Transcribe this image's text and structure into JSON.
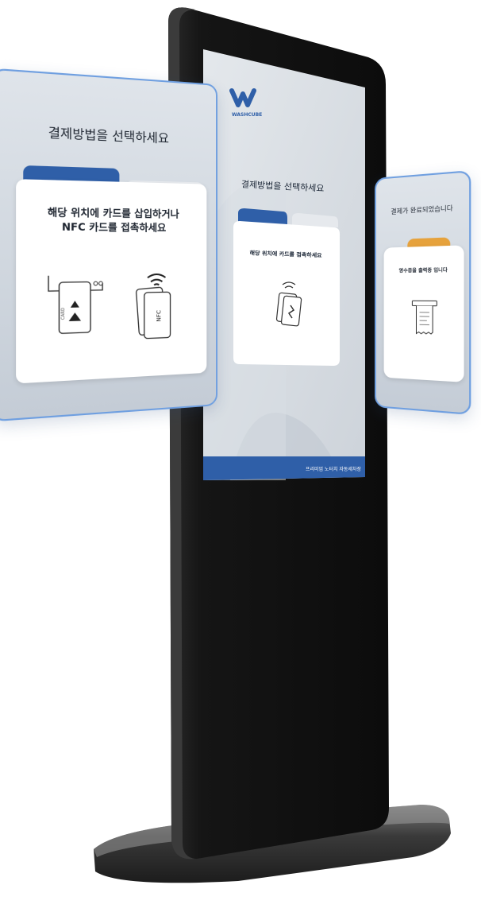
{
  "brand": {
    "name": "WASHCUBE"
  },
  "kiosk_screen": {
    "title": "결제방법을 선택하세요",
    "card_instruction": "해당 위치에 카드를 접촉하세요",
    "footer_text": "프리미엄 노터치 자동세차장"
  },
  "left_panel": {
    "title": "결제방법을 선택하세요",
    "instruction_line1": "해당 위치에 카드를 삽입하거나",
    "instruction_line2": "NFC 카드를 접촉하세요",
    "insert_label": "CARD",
    "nfc_label": "NFC"
  },
  "right_panel": {
    "title": "결제가 완료되었습니다",
    "instruction": "영수증을 출력중 입니다"
  },
  "colors": {
    "accent_blue": "#2f5fa8",
    "accent_orange": "#e6a23c",
    "panel_border": "#6f9fe0",
    "kiosk_body": "#1a1a1a"
  }
}
